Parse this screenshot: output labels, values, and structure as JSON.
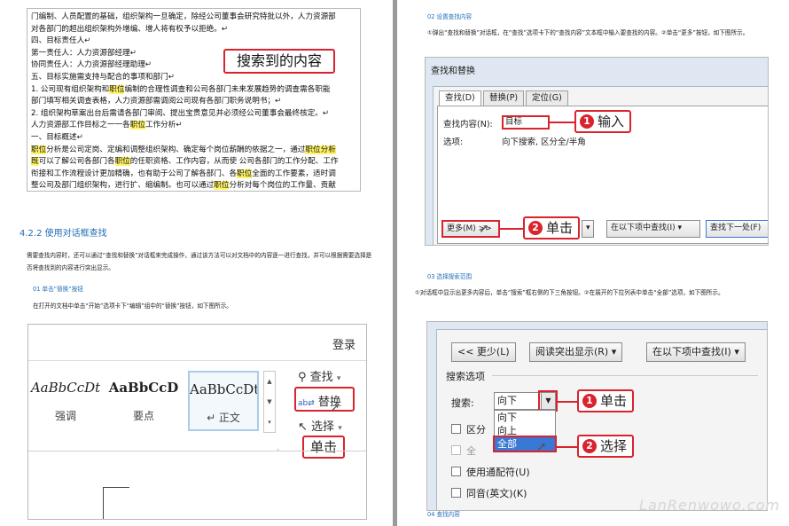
{
  "left": {
    "doc_lines": [
      [
        {
          "t": "门编制、人员配置的基础，组织架构一旦确定，除经公司董事会研究特批以外，人力资源部"
        }
      ],
      [
        {
          "t": "对各部门的超出组织架构外增编、增人将有权予以拒绝。↵"
        }
      ],
      [
        {
          "t": "四、目标责任人↵"
        }
      ],
      [
        {
          "t": "第一责任人：人力资源部经理↵"
        }
      ],
      [
        {
          "t": "协同责任人：人力资源部经理助理↵"
        }
      ],
      [
        {
          "t": "五、目标实施需支持与配合的事项和部门↵"
        }
      ],
      [
        {
          "t": "1. 公司现有组织架构和"
        },
        {
          "t": "职位",
          "h": true
        },
        {
          "t": "编制的合理性调查和公司各部门未来发展趋势的调查需各职能"
        }
      ],
      [
        {
          "t": "部门填写相关调查表格，人力资源部需调阅公司现有各部门职务说明书；↵"
        }
      ],
      [
        {
          "t": "2. 组织架构草案出台后需请各部门审阅、提出宝贵意见并必须经公司董事会最终核定。↵"
        }
      ],
      [
        {
          "t": "人力资源部工作目标之一一各"
        },
        {
          "t": "职位",
          "h": true
        },
        {
          "t": "工作分析↵"
        }
      ],
      [
        {
          "t": "一、目标概述↵"
        }
      ],
      [
        {
          "t": "职位",
          "h": true
        },
        {
          "t": "分析是公司定岗、定编和调整组织架构、确定每个岗位薪酬的依据之一，通过"
        },
        {
          "t": "职位分析",
          "h": true
        }
      ],
      [
        {
          "t": "既",
          "h": true
        },
        {
          "t": "可以了解公司各部门各"
        },
        {
          "t": "职位",
          "h": true
        },
        {
          "t": "的任职资格、工作内容，从而使 公司各部门的工作分配、工作"
        }
      ],
      [
        {
          "t": "衔接和工作流程设计更加精确，也有助于公司了解各部门、各"
        },
        {
          "t": "职位",
          "h": true
        },
        {
          "t": "全面的工作要素，适时调"
        }
      ],
      [
        {
          "t": "整公司及部门组织架构，进行扩、缩编制。也可以通过"
        },
        {
          "t": "职位",
          "h": true
        },
        {
          "t": "分析对每个岗位的工作量、贡献"
        }
      ]
    ],
    "search_callout": "搜索到的内容",
    "section_title": "4.2.2   使用对话框查找",
    "intro_para": "需要查找内容时，还可以通过“查找和替换”对话框来完成操作，通过该方法可以对文档中的内容逐一进行查找，并可以根据需要选择是否将查找到的内容进行突出显示。",
    "sub1_title": "01   单击“替换”按钮",
    "sub1_para": "在打开的文档中单击“开始”选项卡下“编辑”组中的“替换”按钮，如下图所示。",
    "ribbon": {
      "login": "登录",
      "styles": [
        {
          "sample": "AaBbCcDt",
          "name": "强调",
          "italic": true,
          "bold": false
        },
        {
          "sample": "AaBbCcD",
          "name": "要点",
          "italic": false,
          "bold": true
        },
        {
          "sample": "AaBbCcDt",
          "name": "↵ 正文",
          "italic": false,
          "bold": false
        }
      ],
      "find": "查找",
      "replace": "替换",
      "select": "选择",
      "click_label": "单击"
    }
  },
  "right": {
    "sub2_title": "02   设置查找内容",
    "sub2_para": "①弹出“查找和替换”对话框，在“查找”选项卡下的“查找内容”文本框中输入要查找的内容。②单击“更多”按钮，如下图所示。",
    "dialog": {
      "title": "查找和替换",
      "tabs": [
        "查找(D)",
        "替换(P)",
        "定位(G)"
      ],
      "find_label": "查找内容(N):",
      "find_value": "目标",
      "options_label": "选项:",
      "options_value": "向下搜索, 区分全/半角",
      "more_btn": "更多(M) >>",
      "highlight_btn": "阅读突出显示(R) ▾",
      "find_in_btn": "在以下项中查找(I) ▾",
      "find_next_btn": "查找下一处(F)",
      "callout1": "输入",
      "callout2": "单击"
    },
    "sub3_title": "03   选择搜索范围",
    "sub3_para": "①对话框中显示出更多内容后，单击“搜索”框右侧的下三角按钮。②在展开的下拉列表中单击“全部”选项，如下图所示。",
    "options": {
      "less_btn": "<< 更少(L)",
      "highlight_btn": "阅读突出显示(R) ▾",
      "find_in_btn": "在以下项中查找(I) ▾",
      "group_label": "搜索选项",
      "search_label": "搜索:",
      "search_value": "向下",
      "dropdown": [
        "向下",
        "向上",
        "全部"
      ],
      "chk1": "区分",
      "chk2": "全",
      "chk3": "使用通配符(U)",
      "chk4": "同音(英文)(K)",
      "callout1": "单击",
      "callout2": "选择"
    },
    "sub4_title": "04   查找内容"
  },
  "watermark": "LanRenwowo.com",
  "colors": {
    "accent_red": "#d9232d",
    "highlight": "#fff36a",
    "heading_blue": "#1f6db5"
  }
}
